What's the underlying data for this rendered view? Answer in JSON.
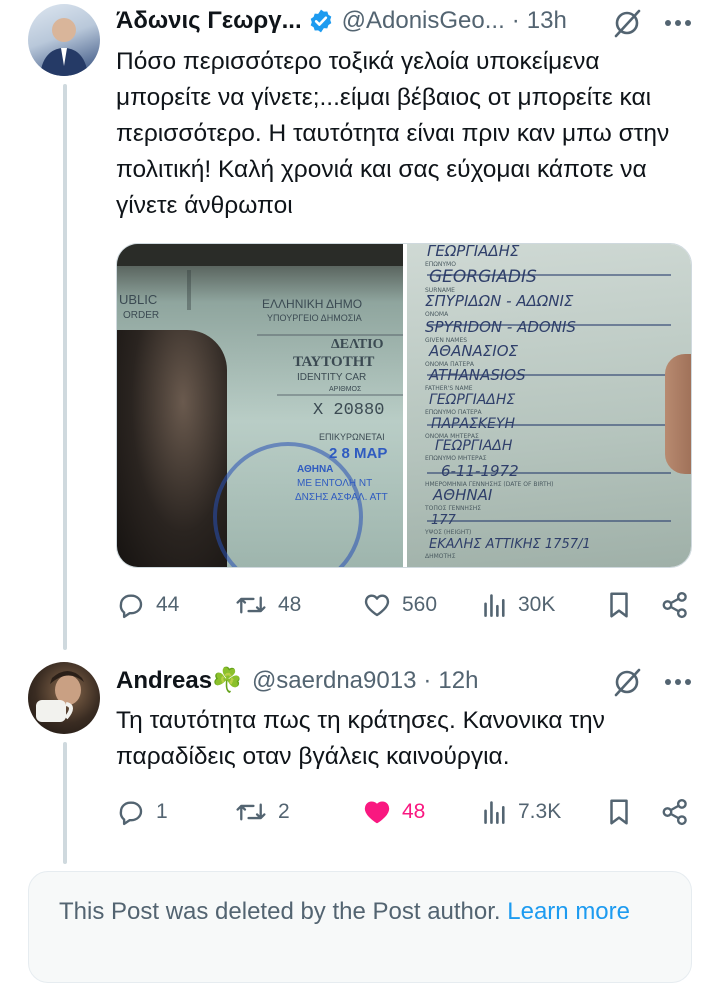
{
  "tweet1": {
    "name": "Άδωνις Γεωργ...",
    "handle": "@AdonisGeo...",
    "dot": "·",
    "time": "13h",
    "text": "Πόσο περισσότερο τοξικά γελοία υποκείμενα μπορείτε να γίνετε;...είμαι βέβαιος οτ μπορείτε και περισσότερο. Η ταυτότητα είναι πριν καν μπω στην πολιτική! Καλή χρονιά και σας εύχομαι κάποτε να γίνετε άνθρωποι",
    "media": {
      "left_texts": [
        "UBLIC",
        "ORDER",
        "ΕΛΛΗΝΙΚΗ ΔΗΜΟ",
        "ΥΠΟΥΡΓΕΙΟ ΔΗΜΟΣΙΑ",
        "ΔΕΛΤΙΟ",
        "ΤΑΥΤΟΤΗΤ",
        "IDENTITY CAR",
        "ΑΡΙΘΜΟΣ",
        "X  20880",
        "ΕΠΙΚΥΡΩΝΕΤΑΙ",
        "2 8 ΜΑΡ",
        "ΑΘΗΝΑ",
        "ΜΕ ΕΝΤΟΛΗ ΝΤ",
        "ΔΝΣΗΣ ΑΣΦΑΛ. ΑΤΤ"
      ],
      "right_texts": [
        "ΓΕΩΡΓΙΑΔΗΣ",
        "ΕΠΩΝΥΜΟ",
        "GEORGIADIS",
        "SURNAME",
        "ΣΠΥΡΙΔΩΝ - ΑΔΩΝΙΣ",
        "ΟΝΟΜΑ",
        "SPYRIDON - ADONIS",
        "GIVEN NAMES",
        "ΑΘΑΝΑΣΙΟΣ",
        "ΟΝΟΜΑ ΠΑΤΕΡΑ",
        "ATHANASIOS",
        "FATHER'S NAME",
        "ΓΕΩΡΓΙΑΔΗΣ",
        "ΕΠΩΝΥΜΟ ΠΑΤΕΡΑ",
        "ΠΑΡΑΣΚΕΥΗ",
        "ΟΝΟΜΑ ΜΗΤΕΡΑΣ",
        "ΓΕΩΡΓΙΑΔΗ",
        "ΕΠΩΝΥΜΟ ΜΗΤΕΡΑΣ",
        "6-11-1972",
        "ΗΜΕΡΟΜΗΝΙΑ ΓΕΝΝΗΣΗΣ (DATE OF BIRTH)",
        "ΑΘΗΝΑΙ",
        "ΤΟΠΟΣ ΓΕΝΝΗΣΗΣ",
        "177",
        "ΥΨΟΣ (HEIGHT)",
        "ΕΚΑΛΗΣ  ΑΤΤΙΚΗΣ 1757/1",
        "ΔΗΜΟΤΗΣ"
      ]
    },
    "actions": {
      "replies": "44",
      "reposts": "48",
      "likes": "560",
      "views": "30K"
    }
  },
  "tweet2": {
    "name": "Andreas",
    "emoji": "☘️",
    "handle": "@saerdna9013",
    "dot": "·",
    "time": "12h",
    "text": "Τη ταυτότητα πως τη κράτησες. Κανονικα την παραδίδεις οταν βγάλεις καινούργια.",
    "actions": {
      "replies": "1",
      "reposts": "2",
      "likes": "48",
      "views": "7.3K"
    }
  },
  "deleted": {
    "text": "This Post was deleted by the Post author.",
    "link": "Learn more"
  },
  "colors": {
    "like_active": "#f91880",
    "link": "#1d9bf0",
    "muted": "#536471",
    "verified": "#1d9bf0"
  }
}
